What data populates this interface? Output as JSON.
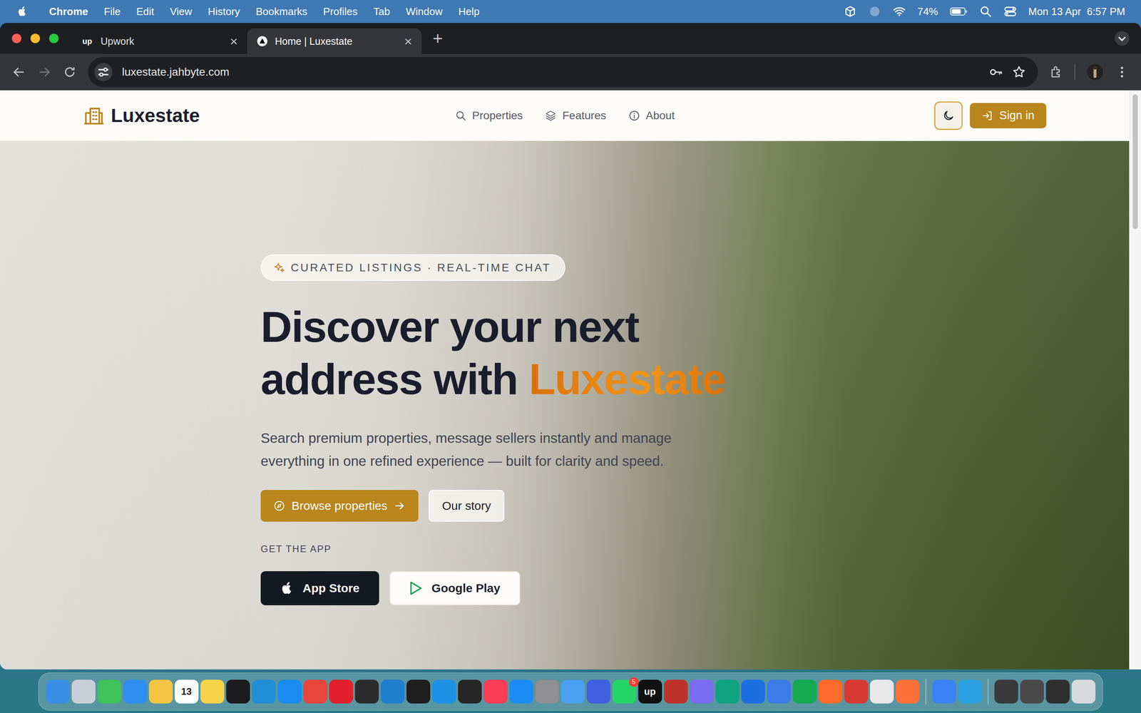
{
  "menubar": {
    "app": "Chrome",
    "items": [
      "File",
      "Edit",
      "View",
      "History",
      "Bookmarks",
      "Profiles",
      "Tab",
      "Window",
      "Help"
    ],
    "battery": "74%",
    "battery_level": 0.74,
    "clock": "Mon 13 Apr  6:57 PM"
  },
  "browser": {
    "tabs": [
      {
        "label": "Upwork",
        "favicon": "up",
        "selected": false
      },
      {
        "label": "Home | Luxestate",
        "favicon": "",
        "selected": true
      }
    ],
    "close": "×",
    "new_tab": "+",
    "url": "luxestate.jahbyte.com"
  },
  "site": {
    "brand": "Luxestate",
    "nav": [
      {
        "label": "Properties",
        "icon": "search"
      },
      {
        "label": "Features",
        "icon": "layers"
      },
      {
        "label": "About",
        "icon": "info"
      }
    ],
    "dark_mode": false,
    "sign_in": "Sign in"
  },
  "hero": {
    "badge": "CURATED LISTINGS · REAL-TIME CHAT",
    "title_line1": "Discover your next",
    "title_line2": "address with",
    "title_accent": "Luxestate",
    "subtitle": "Search premium properties, message sellers instantly and manage everything in one refined experience — built for clarity and speed.",
    "primary": "Browse properties",
    "secondary": "Our story",
    "app_label": "GET THE APP",
    "stores": [
      {
        "label": "App Store",
        "kind": "apple"
      },
      {
        "label": "Google Play",
        "kind": "google"
      }
    ]
  },
  "dock": [
    {
      "kind": "app",
      "color": "#3a8ee6"
    },
    {
      "kind": "app",
      "color": "#c9ced8"
    },
    {
      "kind": "app",
      "color": "#3dc35a"
    },
    {
      "kind": "app",
      "color": "#2f8ff0"
    },
    {
      "kind": "app",
      "color": "#f5c542"
    },
    {
      "kind": "app",
      "color": "#ffffff",
      "text": "13"
    },
    {
      "kind": "app",
      "color": "#f7d34a"
    },
    {
      "kind": "app",
      "color": "#1c1c1e"
    },
    {
      "kind": "app",
      "color": "#1f8fd8"
    },
    {
      "kind": "app",
      "color": "#1a8cf0"
    },
    {
      "kind": "app",
      "color": "#e8453c"
    },
    {
      "kind": "app",
      "color": "#e3202b"
    },
    {
      "kind": "app",
      "color": "#2b2b2b"
    },
    {
      "kind": "app",
      "color": "#1e7fd1"
    },
    {
      "kind": "app",
      "color": "#1e1e1e"
    },
    {
      "kind": "app",
      "color": "#1d91e6"
    },
    {
      "kind": "app",
      "color": "#262626"
    },
    {
      "kind": "app",
      "color": "#fa3e55"
    },
    {
      "kind": "app",
      "color": "#1b8cf5"
    },
    {
      "kind": "app",
      "color": "#8e8e93"
    },
    {
      "kind": "app",
      "color": "#4aa0f0"
    },
    {
      "kind": "app",
      "color": "#4060e0"
    },
    {
      "kind": "app",
      "color": "#25d366",
      "badge": "5"
    },
    {
      "kind": "app",
      "color": "#111111",
      "text": "up"
    },
    {
      "kind": "app",
      "color": "#c0332a"
    },
    {
      "kind": "app",
      "color": "#7b6cf0"
    },
    {
      "kind": "app",
      "color": "#10a37f"
    },
    {
      "kind": "app",
      "color": "#1c6fe0"
    },
    {
      "kind": "app",
      "color": "#3d7be8"
    },
    {
      "kind": "app",
      "color": "#13aa52"
    },
    {
      "kind": "app",
      "color": "#ff6b2b"
    },
    {
      "kind": "app",
      "color": "#d63b33"
    },
    {
      "kind": "app",
      "color": "#e8e8e8"
    },
    {
      "kind": "app",
      "color": "#ff7139"
    },
    {
      "kind": "separator",
      "color": "#dddddd"
    },
    {
      "kind": "app",
      "color": "#3b82f6"
    },
    {
      "kind": "app",
      "color": "#2aa0e0"
    },
    {
      "kind": "separator",
      "color": "#dddddd"
    },
    {
      "kind": "app",
      "color": "#3a3a3a"
    },
    {
      "kind": "app",
      "color": "#4a4a4a"
    },
    {
      "kind": "app",
      "color": "#2f2f2f"
    },
    {
      "kind": "app",
      "color": "#d7d9dc"
    }
  ]
}
